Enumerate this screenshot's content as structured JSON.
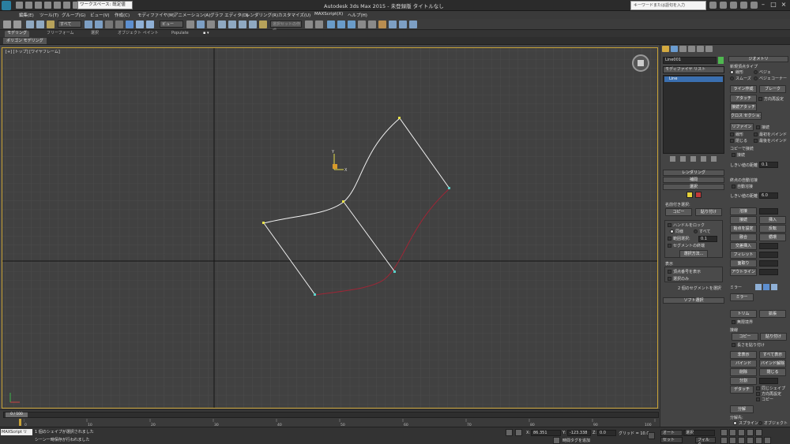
{
  "window": {
    "workspace_label": "ワークスペース: 既定値",
    "title": "Autodesk 3ds Max  2015   -  未登録版    タイトルなし",
    "search_placeholder": "キーワードまたは語句を入力"
  },
  "menus": [
    "編集(E)",
    "ツール(T)",
    "グループ(G)",
    "ビュー(V)",
    "作成(C)",
    "モディファイヤ(M)",
    "アニメーション(A)",
    "グラフ エディタ(D)",
    "レンダリング(R)",
    "カスタマイズ(U)",
    "MAXScript(X)",
    "ヘルプ(H)"
  ],
  "toolbar": {
    "selection_filter": "すべて",
    "view_dropdown": "ビュー",
    "named_selection": "選択セットの作成"
  },
  "ribbon": {
    "tabs": [
      "モデリング",
      "フリーフォーム",
      "選択",
      "オブジェクト ペイント",
      "Populate"
    ],
    "active_tab": 0,
    "subtab": "ポリゴン モデリング"
  },
  "viewport": {
    "label": "[+] [トップ] [ワイヤフレーム]",
    "grid_color": "#525252",
    "spline_color": "#f2f2f2",
    "curve_color": "#9e2636",
    "vertex_color": "#e6e04a"
  },
  "command_panel": {
    "object_name": "Line001",
    "modifier_list": "モディファイヤ リスト",
    "stack_items": [
      "Line"
    ],
    "rollouts_left": [
      "レンダリング",
      "補間",
      "選択",
      "ソフト選択"
    ],
    "named_selection_label": "名前付き選択:",
    "copy": "コピー",
    "paste": "貼り付け",
    "lock_handles": "ハンドルをロック",
    "alike": "同様",
    "all": "すべて",
    "area_selection": "範囲選択:",
    "area_value": "0.1",
    "segment_end": "セグメントの終端",
    "select_by": "選択方法...",
    "display": "表示",
    "show_vertex_numbers": "頂点番号を表示",
    "selected_only": "選択のみ",
    "selection_info": "2 個のセグメントを選択",
    "geometry_title": "ジオメトリ",
    "new_vertex_type": "新規頂点タイプ",
    "vt_linear": "線形",
    "vt_bezier": "ベジェ",
    "vt_smooth": "スムーズ",
    "vt_bezier_corner": "ベジェコーナー",
    "btn_create_line": "ライン作成",
    "btn_break": "ブレーク",
    "btn_attach": "アタッチ",
    "attach_reorient": "方向再設定",
    "btn_attach_multi": "接続アタッチ",
    "btn_cross_section": "クロス セクション",
    "btn_refine": "リファイン",
    "connect": "接続",
    "linear": "線形",
    "bind_first": "最初をバインド",
    "closed": "閉じる",
    "bind_last": "最後をバインド",
    "connect_copy": "コピーで接続",
    "threshold_label": "しきい値の距離",
    "threshold_value": "0.1",
    "end_auto_weld": "終点の自動溶接",
    "auto_weld": "自動溶接",
    "weld_threshold_value": "6.0",
    "btn_weld": "溶接",
    "btn_connect": "接続",
    "btn_insert": "挿入",
    "btn_make_first": "始点を設定",
    "btn_reverse": "反転",
    "btn_fuse": "融合",
    "btn_cycle": "循環",
    "btn_cross_insert": "交差挿入",
    "btn_fillet": "フィレット",
    "btn_chamfer": "面取り",
    "btn_outline": "アウトライン",
    "mirror_label": "ミラー",
    "btn_mirror": "ミラー",
    "btn_trim": "トリム",
    "btn_extend": "拡張",
    "infinite_bounds": "無限境界",
    "tangent": "接線",
    "btn_tangent_copy": "コピー",
    "btn_tangent_paste": "貼り付け",
    "paste_length": "長さを貼り付け",
    "btn_hide": "非表示",
    "btn_unhide_all": "すべて表示",
    "btn_bind": "バインド",
    "btn_unbind": "バインド解除",
    "btn_delete": "削除",
    "btn_close": "閉じる",
    "btn_divide": "分割",
    "btn_detach": "デタッチ",
    "same_shape": "同じシェイプ",
    "reorient": "方向再設定",
    "detach_copy": "コピー",
    "explode": "分解",
    "explode_to": "分解先:",
    "to_spline": "スプライン",
    "to_object": "オブジェクト"
  },
  "timeline": {
    "thumb": "0 / 100",
    "ticks": [
      "0",
      "10",
      "20",
      "30",
      "40",
      "50",
      "60",
      "70",
      "80",
      "90",
      "100"
    ]
  },
  "status": {
    "maxscript": "MAXScript リ",
    "line1": "1 個のシェイプが選択されました",
    "line2": "シーン一時保存が行われました",
    "x_label": "X:",
    "x_value": "86.351",
    "y_label": "Y:",
    "y_value": "-123.338",
    "z_label": "Z:",
    "z_value": "0.0",
    "grid": "グリッド = 10.0",
    "time_tag": "時間タグを追加",
    "auto_key": "オート",
    "set_key": "セット",
    "selected": "選択",
    "filter": "フィルタ...",
    "key_mode": "キー"
  }
}
